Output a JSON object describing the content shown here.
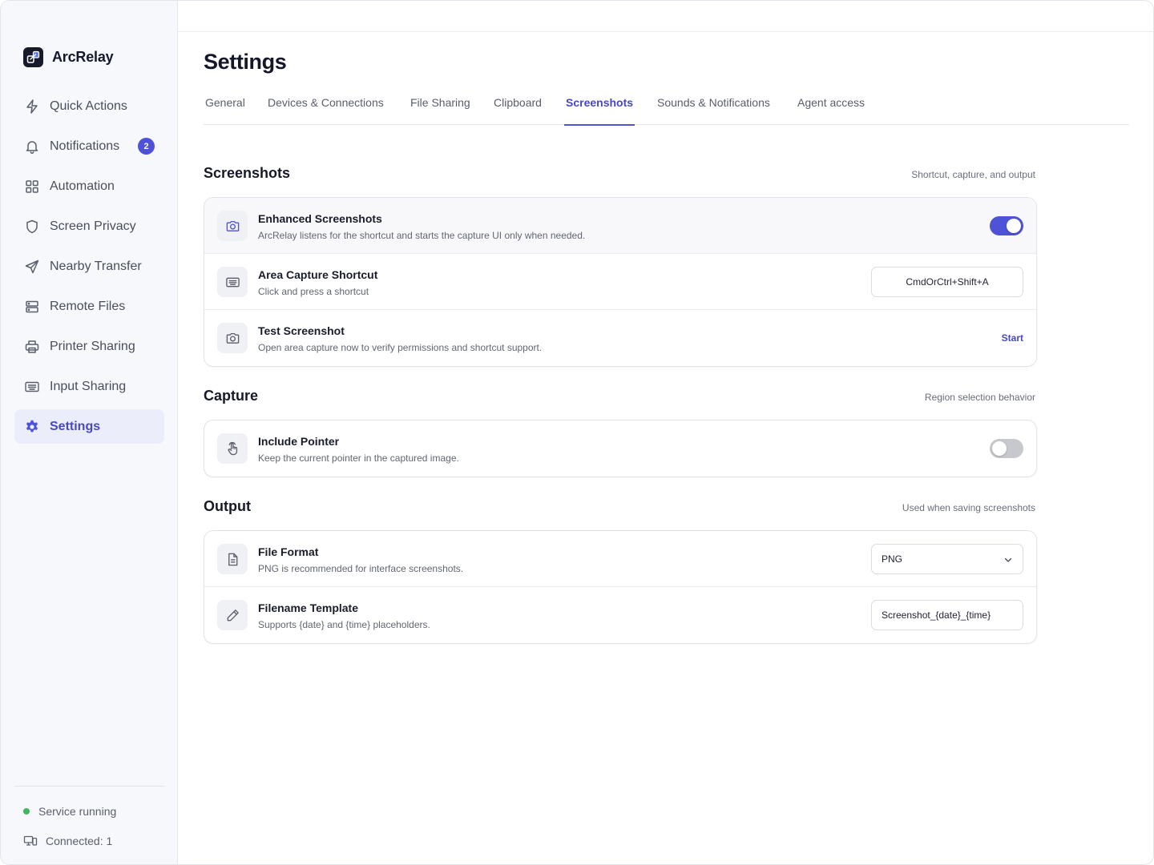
{
  "app": {
    "name": "ArcRelay",
    "logo_icon": "arcrelay-logo-icon"
  },
  "sidebar": {
    "items": [
      {
        "label": "Quick Actions",
        "icon": "lightning-icon"
      },
      {
        "label": "Notifications",
        "icon": "bell-icon",
        "badge": "2"
      },
      {
        "label": "Automation",
        "icon": "grid-icon"
      },
      {
        "label": "Screen Privacy",
        "icon": "shield-icon"
      },
      {
        "label": "Nearby Transfer",
        "icon": "send-icon"
      },
      {
        "label": "Remote Files",
        "icon": "server-icon"
      },
      {
        "label": "Printer Sharing",
        "icon": "printer-icon"
      },
      {
        "label": "Input Sharing",
        "icon": "keyboard-icon"
      },
      {
        "label": "Settings",
        "icon": "gear-icon",
        "active": true
      }
    ],
    "status": {
      "service": "Service running",
      "connected": "Connected: 1"
    }
  },
  "page": {
    "title": "Settings"
  },
  "tabs": [
    {
      "label": "General"
    },
    {
      "label": "Devices & Connections"
    },
    {
      "label": "File Sharing"
    },
    {
      "label": "Clipboard"
    },
    {
      "label": "Screenshots",
      "active": true
    },
    {
      "label": "Sounds & Notifications"
    },
    {
      "label": "Agent access"
    }
  ],
  "sections": {
    "screenshots": {
      "title": "Screenshots",
      "subtitle": "Shortcut, capture, and output",
      "rows": {
        "enhanced": {
          "title": "Enhanced Screenshots",
          "desc": "ArcRelay listens for the shortcut and starts the capture UI only when needed.",
          "enabled": true
        },
        "shortcut": {
          "title": "Area Capture Shortcut",
          "desc": "Click and press a shortcut",
          "value": "CmdOrCtrl+Shift+A"
        },
        "test": {
          "title": "Test Screenshot",
          "desc": "Open area capture now to verify permissions and shortcut support.",
          "action": "Start"
        }
      }
    },
    "capture": {
      "title": "Capture",
      "subtitle": "Region selection behavior",
      "rows": {
        "pointer": {
          "title": "Include Pointer",
          "desc": "Keep the current pointer in the captured image.",
          "enabled": false
        }
      }
    },
    "output": {
      "title": "Output",
      "subtitle": "Used when saving screenshots",
      "rows": {
        "format": {
          "title": "File Format",
          "desc": "PNG is recommended for interface screenshots.",
          "value": "PNG"
        },
        "template": {
          "title": "Filename Template",
          "desc": "Supports {date} and {time} placeholders.",
          "value": "Screenshot_{date}_{time}"
        }
      }
    }
  },
  "colors": {
    "accent": "#4E52D6",
    "status_green": "#3FB95A",
    "sidebar_bg": "#F7F8FB"
  }
}
